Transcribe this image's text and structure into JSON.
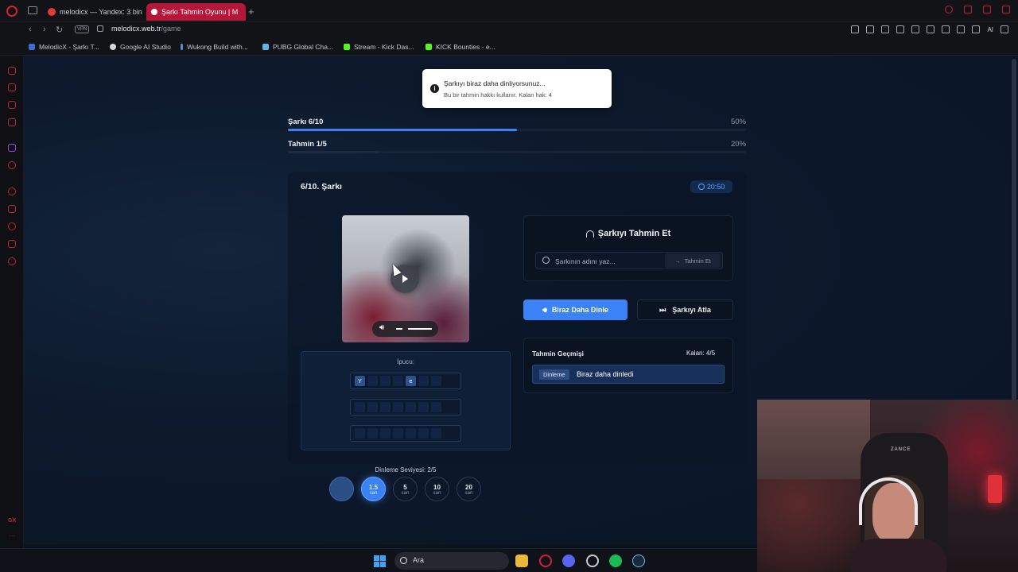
{
  "browser": {
    "tabs": [
      {
        "label": "melodicx — Yandex: 3 bin",
        "active": false
      },
      {
        "label": "Şarkı Tahmin Oyunu | M",
        "active": true
      }
    ],
    "vpn_label": "VPN",
    "url_domain": "melodicx.web.tr",
    "url_path": "/game",
    "ai_label": "AI",
    "bookmarks": [
      "MelodicX - Şarkı T...",
      "Google AI Studio",
      "Wukong Build with...",
      "PUBG Global Cha...",
      "Stream - Kick Das...",
      "KICK Bounties - e..."
    ]
  },
  "sidebar": {
    "gx_label": "GX",
    "more_label": "···"
  },
  "toast": {
    "title": "Şarkıyı biraz daha dinliyorsunuz...",
    "description": "Bu bir tahmin hakkı kullanır. Kalan hak: 4"
  },
  "progress": {
    "song": {
      "label": "Şarkı 6/10",
      "percent_label": "50%",
      "value": 0.5
    },
    "guess": {
      "label": "Tahmin 1/5",
      "percent_label": "20%",
      "value": 0.2
    }
  },
  "game": {
    "song_title": "6/10. Şarkı",
    "timer": "20:50",
    "hint_label": "İpucu:",
    "hint_rows": [
      [
        "Y",
        "",
        "",
        "",
        "e",
        "",
        ""
      ],
      [
        "",
        "",
        "",
        "",
        "",
        "",
        ""
      ],
      [
        "",
        "",
        "",
        "",
        "",
        "",
        ""
      ]
    ],
    "listen_level_label": "Dinleme Seviyesi: 2/5",
    "levels": [
      {
        "value": "",
        "unit": "",
        "state": "done"
      },
      {
        "value": "1.5",
        "unit": "san",
        "state": "active"
      },
      {
        "value": "5",
        "unit": "san",
        "state": ""
      },
      {
        "value": "10",
        "unit": "san",
        "state": ""
      },
      {
        "value": "20",
        "unit": "san",
        "state": ""
      }
    ]
  },
  "guess_panel": {
    "title": "Şarkıyı Tahmin Et",
    "input_placeholder": "Şarkının adını yaz...",
    "submit_label": "Tahmin Et"
  },
  "actions": {
    "listen_more": "Biraz Daha Dinle",
    "skip": "Şarkıyı Atla"
  },
  "history": {
    "title": "Tahmin Geçmişi",
    "remaining": "Kalan: 4/5",
    "items": [
      {
        "tag": "Dinleme",
        "text": "Biraz daha dinledi"
      }
    ]
  },
  "webcam": {
    "chair_label": "ZANCE"
  },
  "taskbar": {
    "search_label": "Ara"
  },
  "colors": {
    "accent": "#3b82f6",
    "brand_red": "#c2213d",
    "background": "#0b1220"
  }
}
